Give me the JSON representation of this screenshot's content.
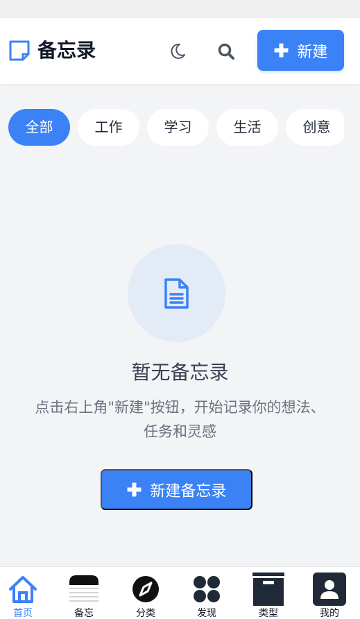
{
  "header": {
    "title": "备忘录",
    "new_button_label": "新建",
    "icons": {
      "brand": "note-icon",
      "moon": "moon-icon",
      "search": "search-icon",
      "plus": "plus-icon"
    }
  },
  "filters": {
    "tabs": [
      {
        "label": "全部",
        "active": true
      },
      {
        "label": "工作",
        "active": false
      },
      {
        "label": "学习",
        "active": false
      },
      {
        "label": "生活",
        "active": false
      },
      {
        "label": "创意",
        "active": false
      }
    ]
  },
  "empty_state": {
    "icon": "document-icon",
    "title": "暂无备忘录",
    "description_line1": "点击右上角\"新建\"按钮，开始记录你的想法、",
    "description_line2": "任务和灵感",
    "button_label": "新建备忘录"
  },
  "bottom_nav": {
    "items": [
      {
        "label": "首页",
        "icon": "home-icon",
        "active": true
      },
      {
        "label": "备忘",
        "icon": "memo-icon",
        "active": false
      },
      {
        "label": "分类",
        "icon": "compass-icon",
        "active": false
      },
      {
        "label": "发现",
        "icon": "grid-icon",
        "active": false
      },
      {
        "label": "类型",
        "icon": "archive-icon",
        "active": false
      },
      {
        "label": "我的",
        "icon": "user-icon",
        "active": false
      }
    ]
  },
  "colors": {
    "accent": "#3b82f6",
    "background": "#f3f4f6",
    "surface": "#ffffff",
    "text_primary": "#111827",
    "text_secondary": "#6b7280"
  }
}
